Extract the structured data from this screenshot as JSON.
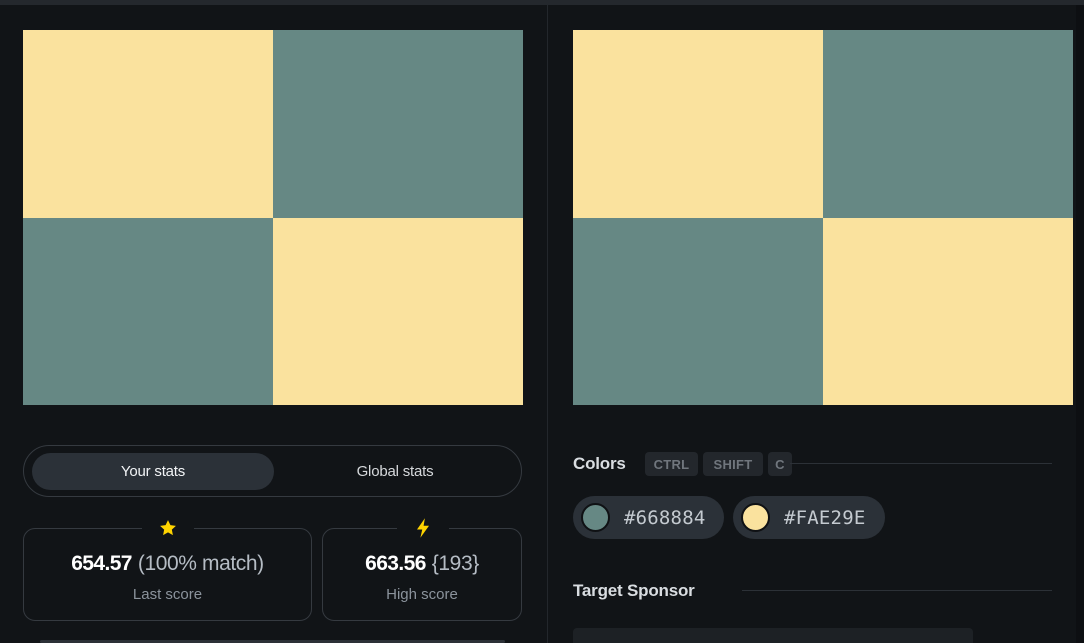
{
  "colors": {
    "color_a": "#FAE29E",
    "color_b": "#668884",
    "background": "#111417",
    "panel_border": "#353a40",
    "chip_bg": "#2b3138",
    "star_icon": "#ffd400",
    "bolt_icon": "#ffd400"
  },
  "left_canvas": {
    "cells": [
      "#FAE29E",
      "#668884",
      "#668884",
      "#FAE29E"
    ]
  },
  "right_canvas": {
    "cells": [
      "#FAE29E",
      "#668884",
      "#668884",
      "#FAE29E"
    ]
  },
  "stats_tabs": {
    "active_label": "Your stats",
    "inactive_label": "Global stats"
  },
  "last_score": {
    "icon": "star-icon",
    "value": "654.57",
    "detail": "(100% match)",
    "caption": "Last score"
  },
  "high_score": {
    "icon": "bolt-icon",
    "value": "663.56",
    "detail": "{193}",
    "caption": "High score"
  },
  "colors_section": {
    "title": "Colors",
    "shortcut": [
      "CTRL",
      "SHIFT",
      "C"
    ],
    "chips": [
      {
        "hex": "#668884",
        "label": "#668884"
      },
      {
        "hex": "#FAE29E",
        "label": "#FAE29E"
      }
    ]
  },
  "sponsor_section": {
    "title": "Target Sponsor"
  }
}
